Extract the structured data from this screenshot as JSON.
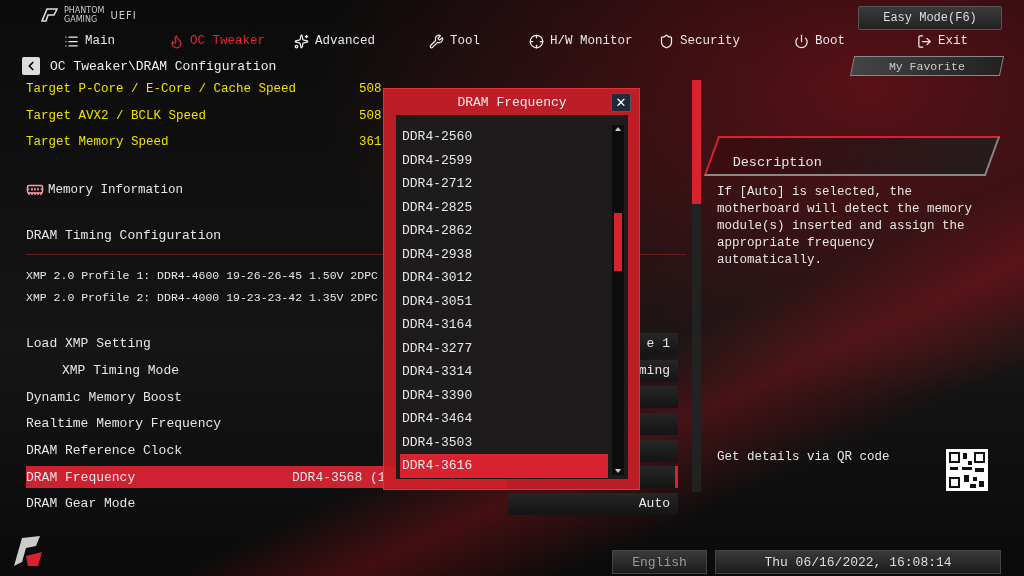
{
  "header": {
    "logo_top": "PHANTOM",
    "logo_bottom": "GAMING",
    "logo_side": "UEFI",
    "easy_mode": "Easy Mode(F6)",
    "favorite": "My Favorite"
  },
  "tabs": [
    {
      "label": "Main",
      "selected": false
    },
    {
      "label": "OC Tweaker",
      "selected": true
    },
    {
      "label": "Advanced",
      "selected": false
    },
    {
      "label": "Tool",
      "selected": false
    },
    {
      "label": "H/W Monitor",
      "selected": false
    },
    {
      "label": "Security",
      "selected": false
    },
    {
      "label": "Boot",
      "selected": false
    },
    {
      "label": "Exit",
      "selected": false
    }
  ],
  "breadcrumb": "OC Tweaker\\DRAM Configuration",
  "items": [
    {
      "kind": "target",
      "label": "Target P-Core / E-Core / Cache Speed",
      "value": "508"
    },
    {
      "kind": "target",
      "label": "Target AVX2 / BCLK Speed",
      "value": "508"
    },
    {
      "kind": "target",
      "label": "Target Memory Speed",
      "value": "361"
    },
    {
      "kind": "section",
      "label": "Memory Information"
    },
    {
      "kind": "heading",
      "label": "DRAM Timing Configuration"
    },
    {
      "kind": "info",
      "label": "XMP 2.0 Profile 1: DDR4-4600 19-26-26-45 1.50V 2DPC"
    },
    {
      "kind": "info",
      "label": "XMP 2.0 Profile 2: DDR4-4000 19-23-23-42 1.35V 2DPC"
    },
    {
      "kind": "setting",
      "label": "Load XMP Setting",
      "value": "e 1",
      "selected": false,
      "children": [
        {
          "kind": "setting",
          "label": "XMP Timing Mode",
          "value": "ming",
          "selected": false
        }
      ]
    },
    {
      "kind": "setting",
      "label": "Dynamic Memory Boost",
      "selected": false
    },
    {
      "kind": "setting",
      "label": "Realtime Memory Frequency",
      "selected": false
    },
    {
      "kind": "setting",
      "label": "DRAM Reference Clock",
      "selected": false
    },
    {
      "kind": "setting",
      "label": "DRAM Frequency",
      "detail": "DDR4-3568 (1",
      "selected": true
    },
    {
      "kind": "setting",
      "label": "DRAM Gear Mode",
      "value": "Auto",
      "selected": false
    }
  ],
  "popup": {
    "title": "DRAM Frequency",
    "close": "✕",
    "options": [
      {
        "label": "DDR4-2560",
        "selected": false
      },
      {
        "label": "DDR4-2599",
        "selected": false
      },
      {
        "label": "DDR4-2712",
        "selected": false
      },
      {
        "label": "DDR4-2825",
        "selected": false
      },
      {
        "label": "DDR4-2862",
        "selected": false
      },
      {
        "label": "DDR4-2938",
        "selected": false
      },
      {
        "label": "DDR4-3012",
        "selected": false
      },
      {
        "label": "DDR4-3051",
        "selected": false
      },
      {
        "label": "DDR4-3164",
        "selected": false
      },
      {
        "label": "DDR4-3277",
        "selected": false
      },
      {
        "label": "DDR4-3314",
        "selected": false
      },
      {
        "label": "DDR4-3390",
        "selected": false
      },
      {
        "label": "DDR4-3464",
        "selected": false
      },
      {
        "label": "DDR4-3503",
        "selected": false
      },
      {
        "label": "DDR4-3616",
        "selected": true
      }
    ]
  },
  "description": {
    "title": "Description",
    "text": "If [Auto] is selected, the motherboard will detect the memory module(s) inserted and assign the appropriate frequency automatically.",
    "qr_text": "Get details via QR code"
  },
  "footer": {
    "language": "English",
    "datetime": "Thu 06/16/2022, 16:08:14"
  }
}
